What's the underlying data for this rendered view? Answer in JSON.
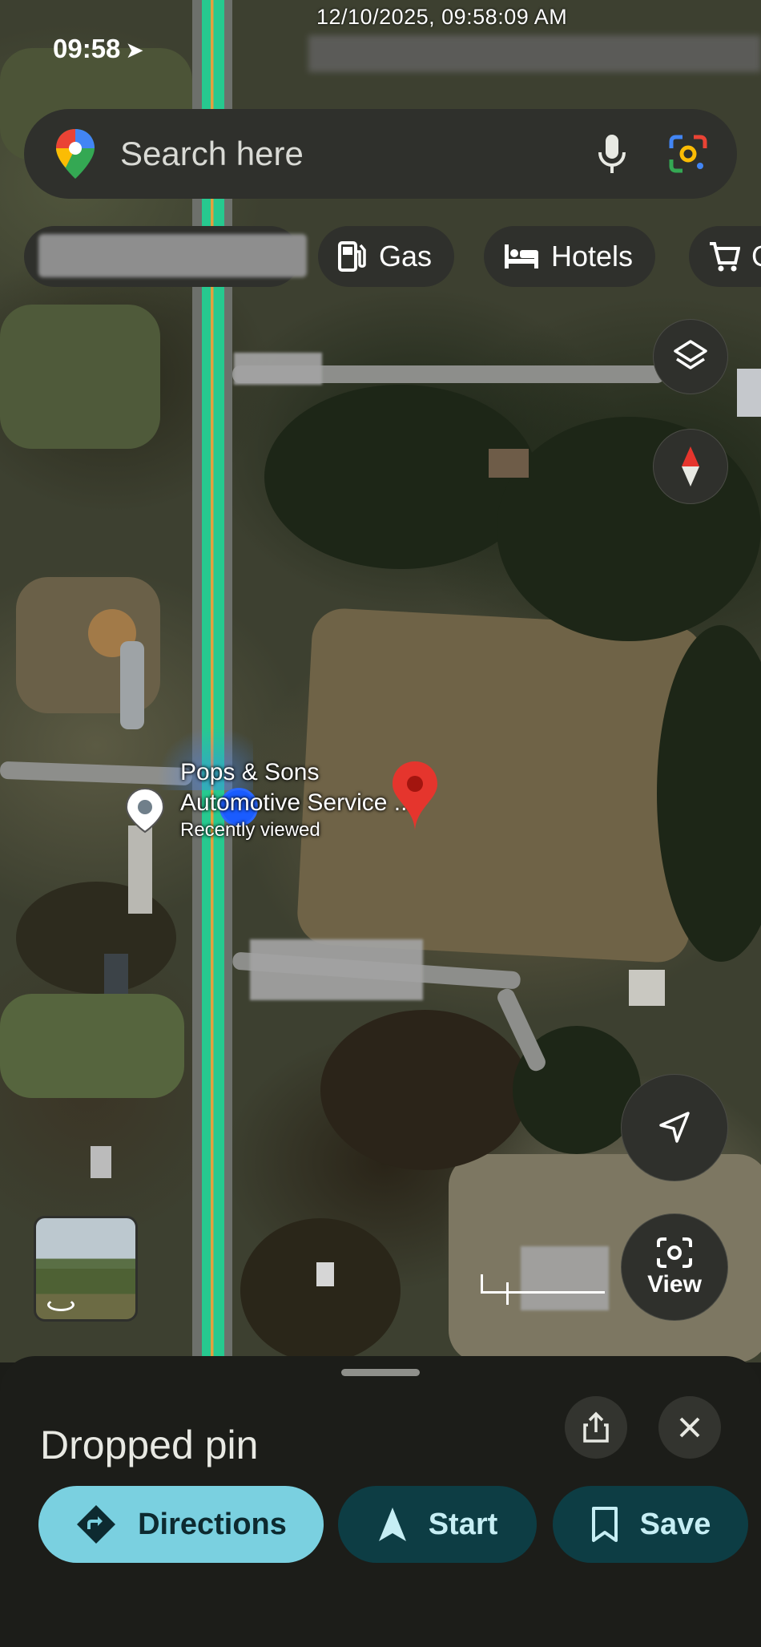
{
  "status_bar": {
    "time": "09:58",
    "screenshot_timestamp": "12/10/2025, 09:58:09 AM"
  },
  "search": {
    "placeholder": "Search here",
    "icons": [
      "google-maps-logo-icon",
      "microphone-icon",
      "google-lens-icon"
    ]
  },
  "chips": [
    {
      "label": "Gas",
      "icon": "gas-station-icon"
    },
    {
      "label": "Hotels",
      "icon": "bed-icon"
    },
    {
      "label": "G",
      "icon": "shopping-cart-icon"
    }
  ],
  "map": {
    "poi": {
      "name_line1": "Pops & Sons",
      "name_line2": "Automotive Service ...",
      "subtitle": "Recently viewed"
    },
    "view_label": "View",
    "colors": {
      "traffic_green": "#27c98f",
      "pin_red": "#e5352d",
      "location_blue": "#1a5cff"
    }
  },
  "sheet": {
    "title": "Dropped pin",
    "directions_label": "Directions",
    "start_label": "Start",
    "save_label": "Save",
    "accent": "#7ad0e0"
  }
}
